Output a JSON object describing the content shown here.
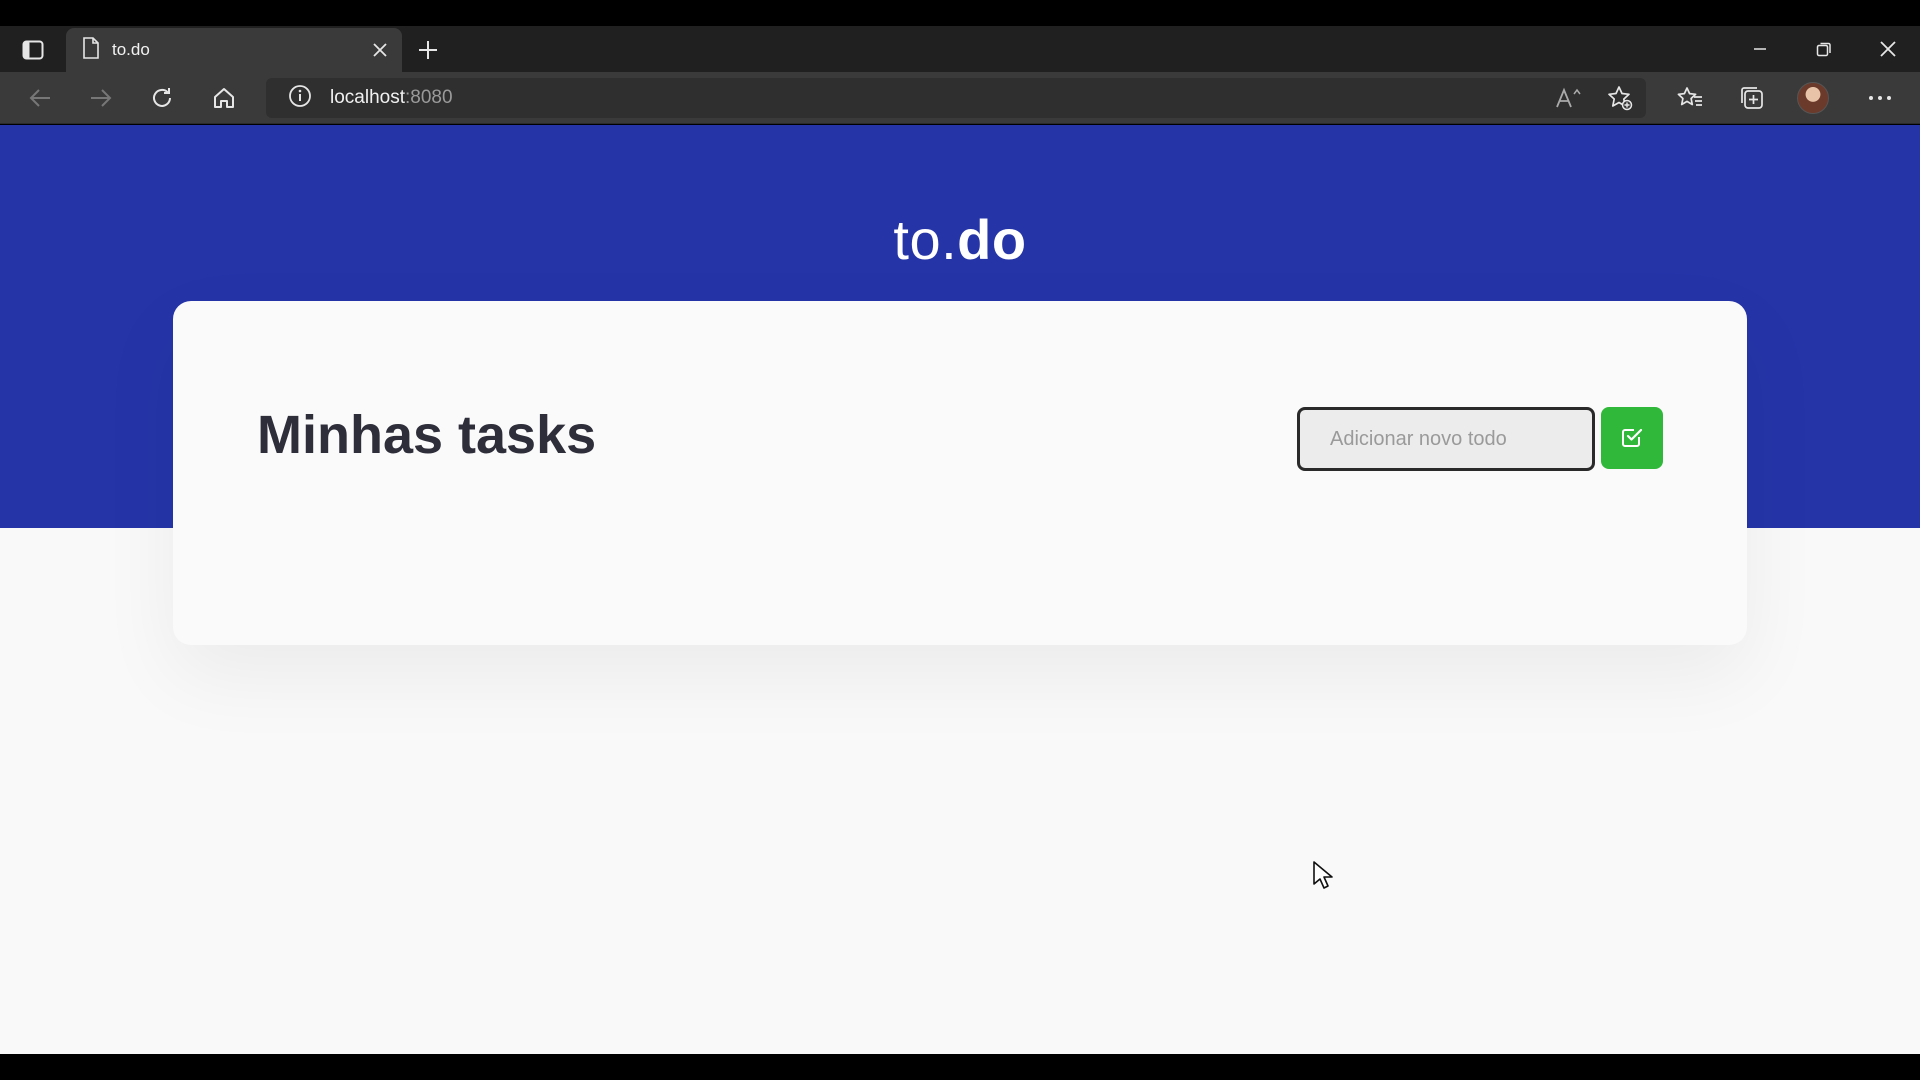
{
  "browser": {
    "tab_title": "to.do",
    "address_host": "localhost",
    "address_port": ":8080",
    "icons": [
      "tab-actions-icon",
      "page-icon",
      "close-icon",
      "plus-icon",
      "minimize-icon",
      "restore-icon",
      "window-close-icon",
      "back-icon",
      "forward-icon",
      "refresh-icon",
      "home-icon",
      "info-icon",
      "read-aloud-icon",
      "add-favorite-icon",
      "favorites-icon",
      "collections-icon",
      "more-icon"
    ]
  },
  "app": {
    "logo_regular": "to.",
    "logo_bold": "do",
    "title": "Minhas tasks",
    "input_placeholder": "Adicionar novo todo",
    "input_value": "",
    "add_button_icon": "check-square-icon",
    "colors": {
      "header_blue": "#2535a8",
      "button_green": "#30b83a",
      "background": "#f9f9f9",
      "title_text": "#2e2e3a"
    }
  }
}
